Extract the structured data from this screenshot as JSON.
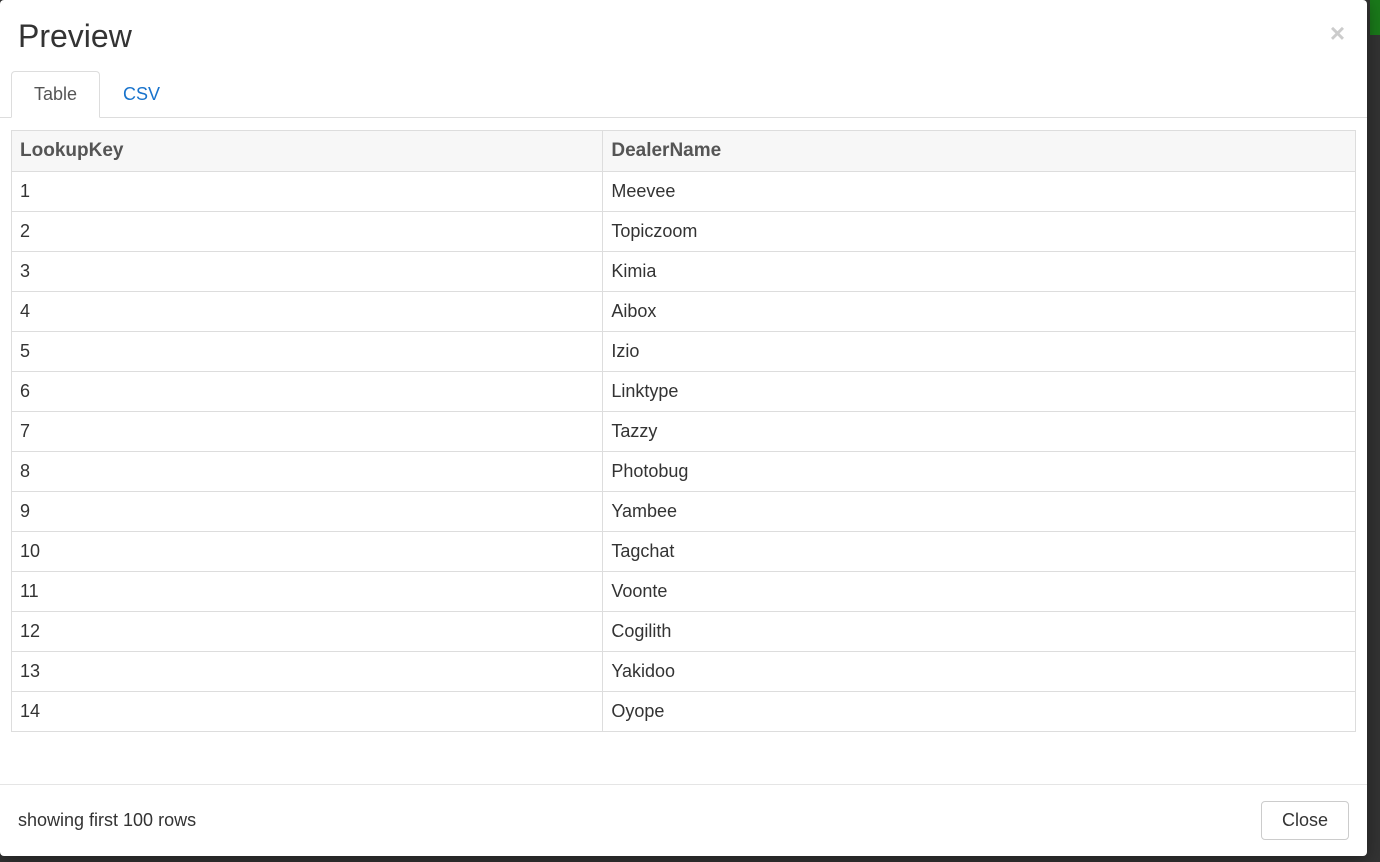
{
  "modal": {
    "title": "Preview",
    "closeIconLabel": "×",
    "tabs": [
      {
        "label": "Table",
        "active": true
      },
      {
        "label": "CSV",
        "active": false
      }
    ],
    "table": {
      "columns": [
        "LookupKey",
        "DealerName"
      ],
      "rows": [
        {
          "key": "1",
          "name": "Meevee"
        },
        {
          "key": "2",
          "name": "Topiczoom"
        },
        {
          "key": "3",
          "name": "Kimia"
        },
        {
          "key": "4",
          "name": "Aibox"
        },
        {
          "key": "5",
          "name": "Izio"
        },
        {
          "key": "6",
          "name": "Linktype"
        },
        {
          "key": "7",
          "name": "Tazzy"
        },
        {
          "key": "8",
          "name": "Photobug"
        },
        {
          "key": "9",
          "name": "Yambee"
        },
        {
          "key": "10",
          "name": "Tagchat"
        },
        {
          "key": "11",
          "name": "Voonte"
        },
        {
          "key": "12",
          "name": "Cogilith"
        },
        {
          "key": "13",
          "name": "Yakidoo"
        },
        {
          "key": "14",
          "name": "Oyope"
        }
      ]
    },
    "footer": {
      "status": "showing first 100 rows",
      "closeLabel": "Close"
    }
  }
}
